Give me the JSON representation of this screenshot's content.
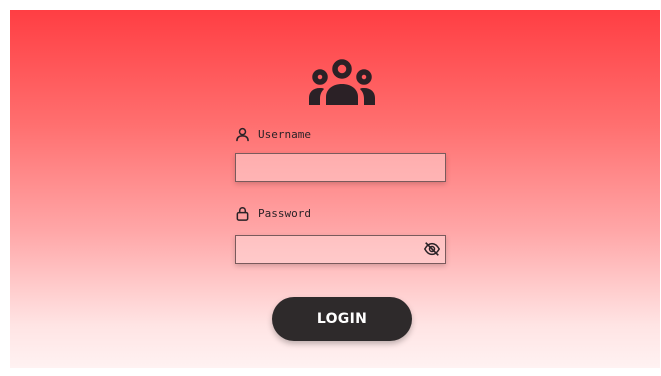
{
  "icons": {
    "header": "users-group-icon",
    "username": "user-icon",
    "password": "lock-icon",
    "visibility": "eye-off-icon"
  },
  "form": {
    "username_label": "Username",
    "username_value": "",
    "password_label": "Password",
    "password_value": "",
    "login_label": "LOGIN"
  },
  "colors": {
    "gradient_top": "#ff3e43",
    "gradient_bottom": "#fff2f2",
    "button": "#2e2a2b",
    "text": "#2a2227"
  }
}
